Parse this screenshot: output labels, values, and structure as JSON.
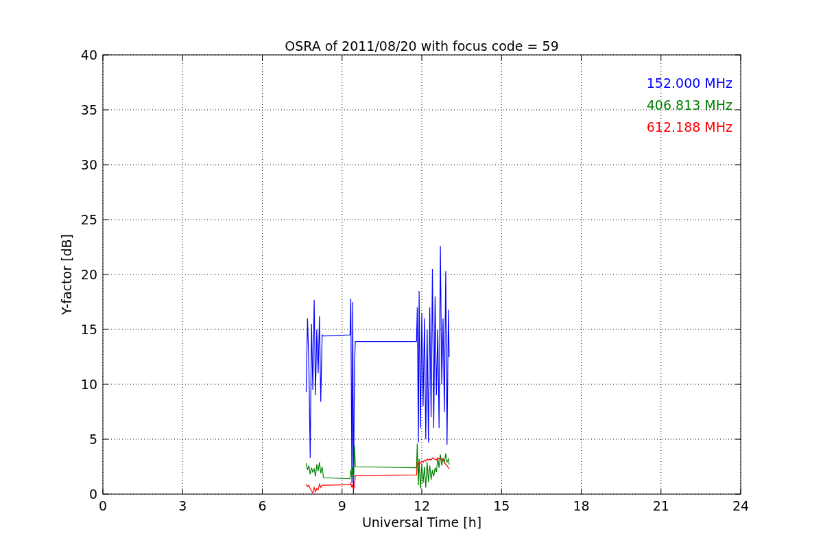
{
  "chart_data": {
    "type": "line",
    "title": "OSRA of 2011/08/20 with focus code = 59",
    "xlabel": "Universal Time [h]",
    "ylabel": "Y-factor [dB]",
    "x": [
      7.65,
      7.7,
      7.75,
      7.8,
      7.85,
      7.9,
      7.95,
      8.0,
      8.05,
      8.1,
      8.15,
      8.2,
      8.25,
      8.3,
      9.3,
      9.33,
      9.37,
      9.4,
      9.43,
      9.47,
      9.5,
      11.8,
      11.83,
      11.87,
      11.9,
      11.95,
      12.0,
      12.05,
      12.1,
      12.15,
      12.2,
      12.25,
      12.3,
      12.35,
      12.4,
      12.45,
      12.5,
      12.55,
      12.6,
      12.65,
      12.7,
      12.75,
      12.8,
      12.85,
      12.9,
      12.95,
      13.0,
      13.03
    ],
    "series": [
      {
        "name": "152.000 MHz",
        "color": "#0000ff",
        "values": [
          9.3,
          16,
          12,
          3.3,
          15.5,
          9.5,
          17.7,
          9,
          15,
          11,
          16.2,
          8.4,
          14.5,
          14.4,
          14.5,
          17.8,
          1,
          17.5,
          0,
          12,
          13.9,
          13.9,
          17,
          4.7,
          18.5,
          6,
          16.5,
          8,
          16,
          5,
          15,
          4.7,
          17,
          7,
          20.5,
          6,
          18,
          9,
          15,
          6,
          22.6,
          10,
          16,
          7.5,
          20.3,
          4.5,
          16.8,
          12.5
        ]
      },
      {
        "name": "406.813 MHz",
        "color": "#008000",
        "values": [
          2.8,
          2.2,
          2.6,
          1.8,
          2.4,
          2,
          2.3,
          1.6,
          2.7,
          2.1,
          2.9,
          1.9,
          2.5,
          1.5,
          1.4,
          2.2,
          1.6,
          2.5,
          1.2,
          4.4,
          2.5,
          2.4,
          4.6,
          0.8,
          3.2,
          0.5,
          2.8,
          1,
          2.5,
          0.6,
          2.9,
          1.1,
          2.6,
          1.3,
          2.2,
          1.6,
          2.4,
          2,
          3.3,
          2.4,
          3.6,
          2.6,
          3.3,
          2.8,
          3.7,
          2.9,
          3.2,
          2.7
        ]
      },
      {
        "name": "612.188 MHz",
        "color": "#ff0000",
        "values": [
          0.9,
          0.7,
          0.8,
          0.5,
          0.3,
          0.1,
          0.6,
          0.2,
          0.5,
          0.4,
          0.9,
          0.6,
          0.8,
          0.8,
          0.85,
          1,
          0.6,
          0.9,
          0.4,
          0.8,
          1.7,
          1.75,
          2.8,
          2.7,
          2.9,
          2.8,
          3,
          2.9,
          3.1,
          3,
          3.2,
          3.1,
          3.2,
          3.1,
          3.3,
          3.2,
          3.2,
          3.1,
          3.3,
          3.2,
          3.3,
          3.1,
          3.2,
          2.9,
          2.7,
          2.6,
          2.4,
          2.3
        ]
      }
    ],
    "grid": true,
    "xlim": [
      0,
      24
    ],
    "ylim": [
      0,
      40
    ],
    "xticks": [
      0,
      3,
      6,
      9,
      12,
      15,
      18,
      21,
      24
    ],
    "yticks": [
      0,
      5,
      10,
      15,
      20,
      25,
      30,
      35,
      40
    ]
  }
}
